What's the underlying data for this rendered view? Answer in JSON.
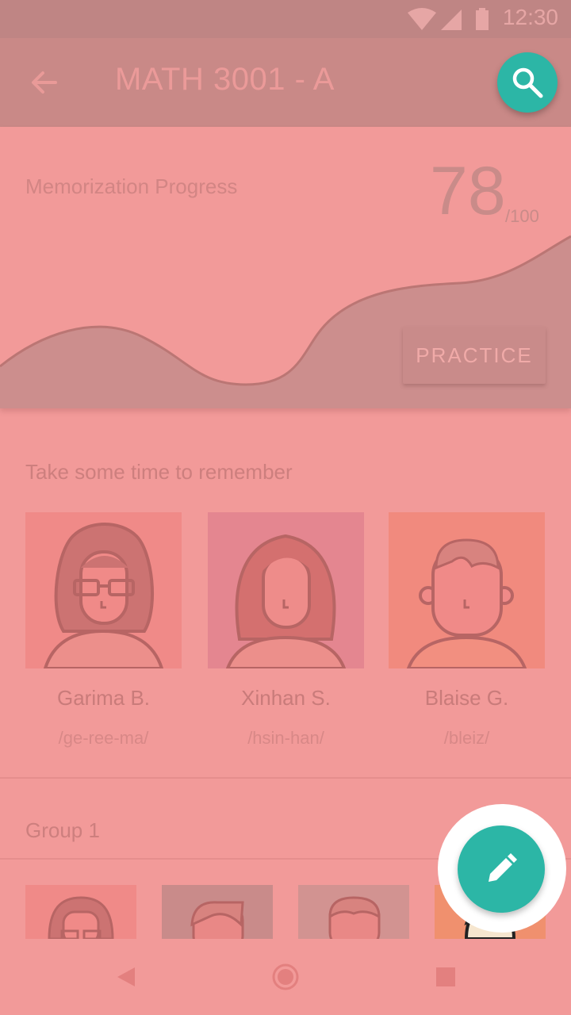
{
  "status_bar": {
    "time": "12:30"
  },
  "app_bar": {
    "title": "MATH 3001 - A"
  },
  "progress": {
    "label": "Memorization Progress",
    "score": "78",
    "max": "/100",
    "practice_label": "PRACTICE"
  },
  "remember": {
    "title": "Take some time to remember",
    "people": [
      {
        "name": "Garima B.",
        "pronunciation": "/ge-ree-ma/"
      },
      {
        "name": "Xinhan S.",
        "pronunciation": "/hsin-han/"
      },
      {
        "name": "Blaise G.",
        "pronunciation": "/bleiz/"
      }
    ]
  },
  "group": {
    "title": "Group 1"
  },
  "colors": {
    "accent": "#2cb6a6",
    "overlay": "#f29a99"
  },
  "icons": [
    "wifi-icon",
    "signal-icon",
    "battery-icon",
    "back-arrow-icon",
    "search-icon",
    "edit-icon",
    "nav-back-icon",
    "nav-home-icon",
    "nav-recents-icon"
  ]
}
